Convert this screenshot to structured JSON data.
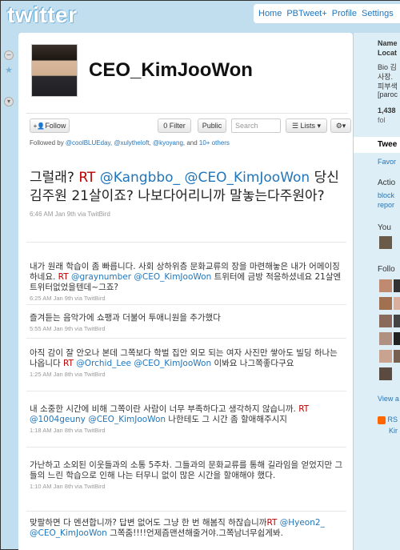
{
  "topbar": {
    "logo": "twitter",
    "nav": [
      "Home",
      "PBTweet+",
      "Profile",
      "Settings"
    ]
  },
  "profile": {
    "screen_name": "CEO_KimJooWon"
  },
  "actions": {
    "follow": "Follow",
    "filter": "0 Filter",
    "public": "Public",
    "search_placeholder": "Search",
    "lists": "Lists",
    "followed_by_prefix": "Followed by",
    "followed_by": [
      "@coolBLUEday",
      "@xulytheloft",
      "@kyoyang"
    ],
    "followed_by_more": "10+ others"
  },
  "tweets": [
    {
      "parts": [
        {
          "t": "그럴래? ",
          "c": "text"
        },
        {
          "t": "RT",
          "c": "rt"
        },
        {
          "t": " ",
          "c": "text"
        },
        {
          "t": "@Kangbbo_",
          "c": "mention"
        },
        {
          "t": " ",
          "c": "text"
        },
        {
          "t": "@CEO_KimJooWon",
          "c": "mention"
        },
        {
          "t": " 당신김주원 21살이죠? 나보다어리니까 말놓는다주원아?",
          "c": "text"
        }
      ],
      "meta": "6:46 AM Jan 9th via TwitBird"
    },
    {
      "parts": [
        {
          "t": "내가 원래 학습이 좀 빠릅니다. 사회 상하위층 문화교류의 장을 마련해놓은 내가 어메이징하네요. ",
          "c": "text"
        },
        {
          "t": "RT",
          "c": "rt"
        },
        {
          "t": " ",
          "c": "text"
        },
        {
          "t": "@graynumber",
          "c": "mention"
        },
        {
          "t": " ",
          "c": "text"
        },
        {
          "t": "@CEO_KimJooWon",
          "c": "mention"
        },
        {
          "t": " 트위터에 금방 적응하셨네요 21살엔 트위터없었을텐데~그죠?",
          "c": "text"
        }
      ],
      "meta": "6:25 AM Jan 9th via TwitBird"
    },
    {
      "parts": [
        {
          "t": "즐겨듣는 음악가에 쇼팽과 더불어 투애니원을 추가했다",
          "c": "text"
        }
      ],
      "meta": "5:55 AM Jan 9th via TwitBird"
    },
    {
      "parts": [
        {
          "t": "아직 감이 잘 안오나 본데 그쪽보다 학벌 집안 외모 되는 여자 사진만 쌓아도 빌딩 하나는 나옵니다 ",
          "c": "text"
        },
        {
          "t": "RT",
          "c": "rt"
        },
        {
          "t": " ",
          "c": "text"
        },
        {
          "t": "@Orchid_Lee",
          "c": "mention"
        },
        {
          "t": " ",
          "c": "text"
        },
        {
          "t": "@CEO_KimJooWon",
          "c": "mention"
        },
        {
          "t": " 이봐요 나그쪽좋다구요",
          "c": "text"
        }
      ],
      "meta": "1:25 AM Jan 8th via TwitBird"
    },
    {
      "parts": [
        {
          "t": "내 소중한 시간에 비해 그쪽이란 사람이 너무 부족하다고 생각하지 않습니까. ",
          "c": "text"
        },
        {
          "t": "RT",
          "c": "rt"
        },
        {
          "t": " ",
          "c": "text"
        },
        {
          "t": "@1004geuny",
          "c": "mention"
        },
        {
          "t": " ",
          "c": "text"
        },
        {
          "t": "@CEO_KimJooWon",
          "c": "mention"
        },
        {
          "t": " 나한테도 그 시간 좀 할애해주시지",
          "c": "text"
        }
      ],
      "meta": "1:18 AM Jan 8th via TwitBird"
    },
    {
      "parts": [
        {
          "t": "가난하고 소외된 이웃들과의 소통 5주차. 그들과의 문화교류를 통해 길라임을 얻었지만 그들의 느린 학습으로 인해 나는 터무니 없이 많은 시간을 할애해야 했다.",
          "c": "text"
        }
      ],
      "meta": "1:10 AM Jan 8th via TwitBird"
    },
    {
      "parts": [
        {
          "t": "맞팔하면 다 멘션합니까? 답변 없어도 그냥 한 번 해봄직 하잖습니까",
          "c": "text"
        },
        {
          "t": "RT",
          "c": "rt"
        },
        {
          "t": " ",
          "c": "text"
        },
        {
          "t": "@Hyeon2_",
          "c": "mention"
        },
        {
          "t": " ",
          "c": "text"
        },
        {
          "t": "@CEO_KimJooWon",
          "c": "mention"
        },
        {
          "t": " 그쪽줌!!!!언제즘맨션해줄거야.그쪽남너무쉽게봐.",
          "c": "text"
        }
      ],
      "meta": ""
    }
  ],
  "sidebar": {
    "name_label": "Name",
    "location_label": "Locat",
    "bio_lines": [
      "Bio 김",
      "사장.",
      "피부색",
      "[paroc"
    ],
    "count": "1,438",
    "count_sub": "fol",
    "tweets_tab": "Twee",
    "favorites": "Favor",
    "actions_title": "Actio",
    "block": "block",
    "report": "repor",
    "you_label": "You",
    "following_title": "Follo",
    "view_all": "View a",
    "rss": "RS",
    "rss_sub": "Kir"
  },
  "colors": {
    "background": "#c0deed",
    "link": "#2276bb",
    "rt": "#b00000",
    "sidebar": "#ddeef6"
  }
}
